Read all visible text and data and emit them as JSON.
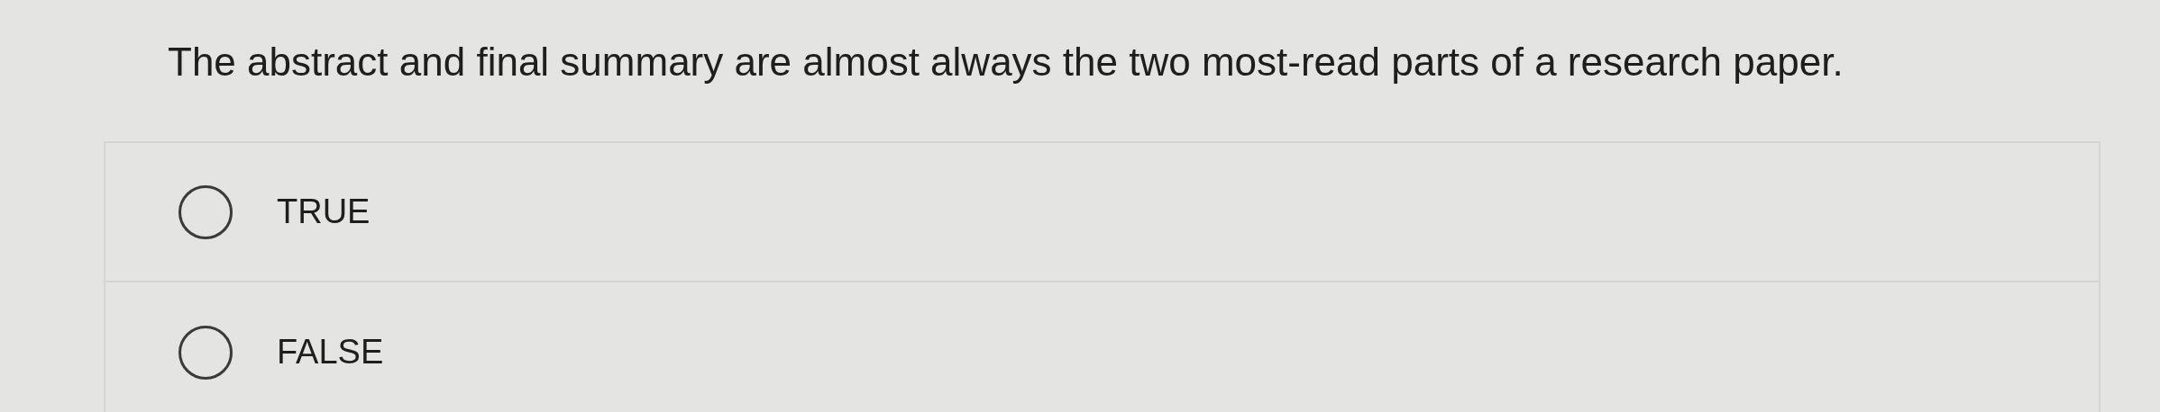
{
  "question": "The abstract and final summary are almost always the two most-read parts of a research paper.",
  "options": [
    {
      "label": "TRUE",
      "selected": false
    },
    {
      "label": "FALSE",
      "selected": false
    }
  ]
}
